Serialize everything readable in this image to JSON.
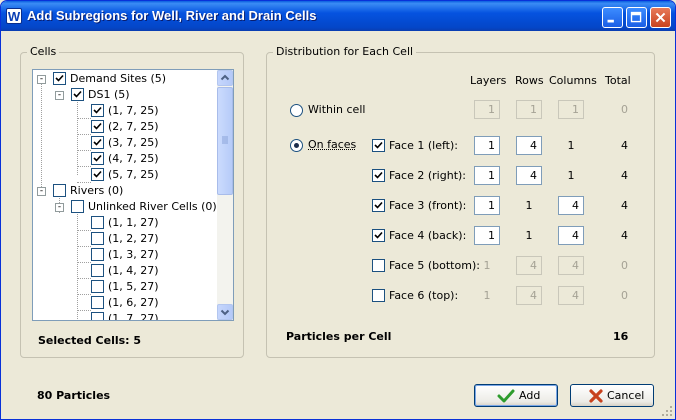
{
  "window": {
    "title": "Add Subregions for Well, River and Drain Cells",
    "app_icon_letter": "W"
  },
  "cells_panel": {
    "group_title": "Cells",
    "tree": [
      {
        "label": "Demand Sites (5)",
        "checked": true,
        "expander": "-"
      },
      {
        "label": "DS1 (5)",
        "checked": true,
        "expander": "-"
      },
      {
        "label": "(1, 7, 25)",
        "checked": true
      },
      {
        "label": "(2, 7, 25)",
        "checked": true
      },
      {
        "label": "(3, 7, 25)",
        "checked": true
      },
      {
        "label": "(4, 7, 25)",
        "checked": true
      },
      {
        "label": "(5, 7, 25)",
        "checked": true
      },
      {
        "label": "Rivers (0)",
        "checked": false,
        "expander": "-"
      },
      {
        "label": "Unlinked River Cells (0)",
        "checked": false,
        "expander": "-"
      },
      {
        "label": "(1, 1, 27)",
        "checked": false
      },
      {
        "label": "(1, 2, 27)",
        "checked": false
      },
      {
        "label": "(1, 3, 27)",
        "checked": false
      },
      {
        "label": "(1, 4, 27)",
        "checked": false
      },
      {
        "label": "(1, 5, 27)",
        "checked": false
      },
      {
        "label": "(1, 6, 27)",
        "checked": false
      },
      {
        "label": "(1, 7, 27)",
        "checked": false
      }
    ],
    "selected_cells_label": "Selected Cells: 5"
  },
  "distribution_panel": {
    "group_title": "Distribution for Each Cell",
    "headers": {
      "layers": "Layers",
      "rows": "Rows",
      "columns": "Columns",
      "total": "Total"
    },
    "within_cell": {
      "label": "Within cell",
      "selected": false,
      "layers": "1",
      "rows": "1",
      "columns": "1",
      "total": "0"
    },
    "on_faces": {
      "label": "On faces",
      "selected": true
    },
    "faces": [
      {
        "label": "Face 1 (left):",
        "checked": true,
        "layers": "1",
        "rows": "4",
        "columns": "1",
        "total": "4"
      },
      {
        "label": "Face 2 (right):",
        "checked": true,
        "layers": "1",
        "rows": "4",
        "columns": "1",
        "total": "4"
      },
      {
        "label": "Face 3 (front):",
        "checked": true,
        "layers": "1",
        "rows": "1",
        "columns": "4",
        "total": "4"
      },
      {
        "label": "Face 4 (back):",
        "checked": true,
        "layers": "1",
        "rows": "1",
        "columns": "4",
        "total": "4"
      },
      {
        "label": "Face 5 (bottom):",
        "checked": false,
        "layers": "1",
        "rows": "4",
        "columns": "4",
        "total": "0"
      },
      {
        "label": "Face 6 (top):",
        "checked": false,
        "layers": "1",
        "rows": "4",
        "columns": "4",
        "total": "0"
      }
    ],
    "particles_per_cell_label": "Particles per Cell",
    "particles_per_cell_value": "16"
  },
  "footer": {
    "particles_label": "80 Particles",
    "add_label": "Add",
    "cancel_label": "Cancel"
  },
  "colors": {
    "title_bar": "#0553e0",
    "dialog_bg": "#ece9d8",
    "ok_check": "#2e9c2e",
    "cancel_x": "#c8421e"
  }
}
